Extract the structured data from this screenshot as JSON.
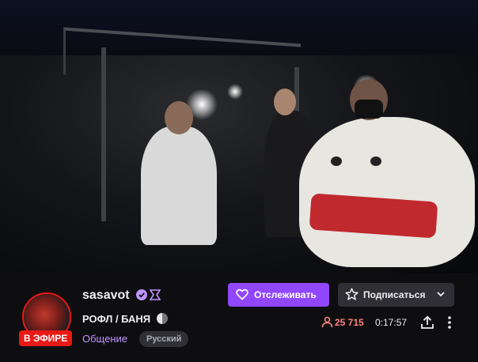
{
  "channel": {
    "name": "sasavot",
    "live_label": "В ЭФИРЕ",
    "stream_title": "РОФЛ / БАНЯ",
    "category": "Общение",
    "tag": "Русский"
  },
  "actions": {
    "follow_label": "Отслеживать",
    "subscribe_label": "Подписаться"
  },
  "stats": {
    "viewers": "25 715",
    "uptime": "0:17:57"
  },
  "colors": {
    "accent": "#9147ff",
    "live": "#e91916",
    "viewers": "#ff8280",
    "category": "#bf94ff"
  }
}
